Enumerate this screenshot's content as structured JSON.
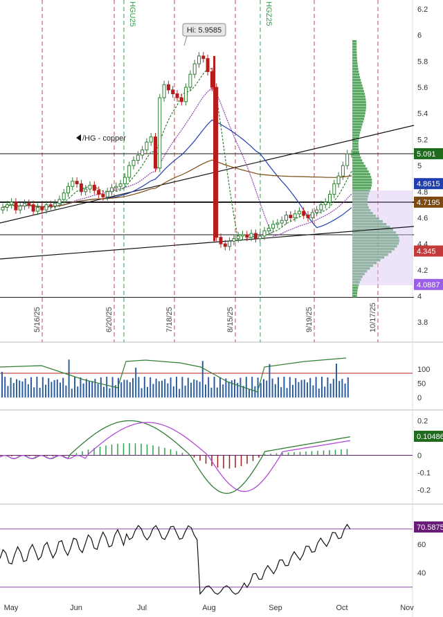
{
  "chart_data": [
    {
      "type": "candlestick",
      "title": "/HG - copper",
      "ylim": [
        3.6,
        6.3
      ],
      "y_ticks": [
        "6.2",
        "6",
        "5.8",
        "5.6",
        "5.4",
        "5.2",
        "5",
        "4.8",
        "4.6",
        "4.4",
        "4.2",
        "4",
        "3.8"
      ],
      "high_annotation": "Hi: 5.9585",
      "price_labels": [
        {
          "value": 5.091,
          "text": "5.091",
          "color": "#1e6b1e"
        },
        {
          "value": 4.8615,
          "text": "4.8615",
          "color": "#1f3fb0"
        },
        {
          "value": 4.7195,
          "text": "4.7195",
          "color": "#7a4a12"
        },
        {
          "value": 4.345,
          "text": "4.345",
          "color": "#c43a3a"
        },
        {
          "value": 4.0887,
          "text": "4.0887",
          "color": "#9b5ee8"
        }
      ],
      "horizontal_lines": [
        5.091,
        4.7195,
        4.47,
        3.99
      ],
      "date_markers": [
        "5/16/25",
        "6/20/25",
        "7/18/25",
        "8/15/25",
        "9/19/25",
        "10/17/25"
      ],
      "contract_markers": [
        "HGU25",
        "HGZ25"
      ],
      "x_ticks": [
        "May",
        "Jun",
        "Jul",
        "Aug",
        "Sep",
        "Oct",
        "Nov"
      ],
      "close_series": [
        4.68,
        4.7,
        4.72,
        4.66,
        4.69,
        4.71,
        4.7,
        4.65,
        4.68,
        4.66,
        4.7,
        4.69,
        4.71,
        4.74,
        4.79,
        4.84,
        4.88,
        4.86,
        4.8,
        4.82,
        4.85,
        4.81,
        4.78,
        4.76,
        4.8,
        4.83,
        4.84,
        4.86,
        4.91,
        5.0,
        5.04,
        5.08,
        5.12,
        5.18,
        5.22,
        4.98,
        5.52,
        5.62,
        5.58,
        5.55,
        5.52,
        5.49,
        5.6,
        5.7,
        5.78,
        5.84,
        5.82,
        5.72,
        5.6,
        4.45,
        4.4,
        4.38,
        4.42,
        4.44,
        4.46,
        4.47,
        4.45,
        4.48,
        4.44,
        4.46,
        4.5,
        4.52,
        4.55,
        4.56,
        4.58,
        4.62,
        4.6,
        4.63,
        4.65,
        4.62,
        4.6,
        4.64,
        4.66,
        4.7,
        4.72,
        4.78,
        4.86,
        4.92,
        5.0,
        5.09,
        5.091
      ],
      "colors": {
        "up": "#2e7d32",
        "down": "#b71c1c",
        "grid": "#b71c1c",
        "green_grid": "#2e9e4a"
      }
    },
    {
      "type": "bar",
      "name": "volume_panel",
      "y_ticks": [
        "100",
        "50",
        "0"
      ]
    },
    {
      "type": "line",
      "name": "momentum_panel",
      "y_ticks": [
        "0.2",
        "0.1",
        "0",
        "-0.1",
        "-0.2"
      ],
      "value_label": "0.10486",
      "ylim": [
        -0.25,
        0.22
      ]
    },
    {
      "type": "line",
      "name": "oscillator_panel",
      "y_ticks": [
        "60",
        "40"
      ],
      "value_label": "70.5875",
      "ylim": [
        25,
        82
      ]
    }
  ]
}
